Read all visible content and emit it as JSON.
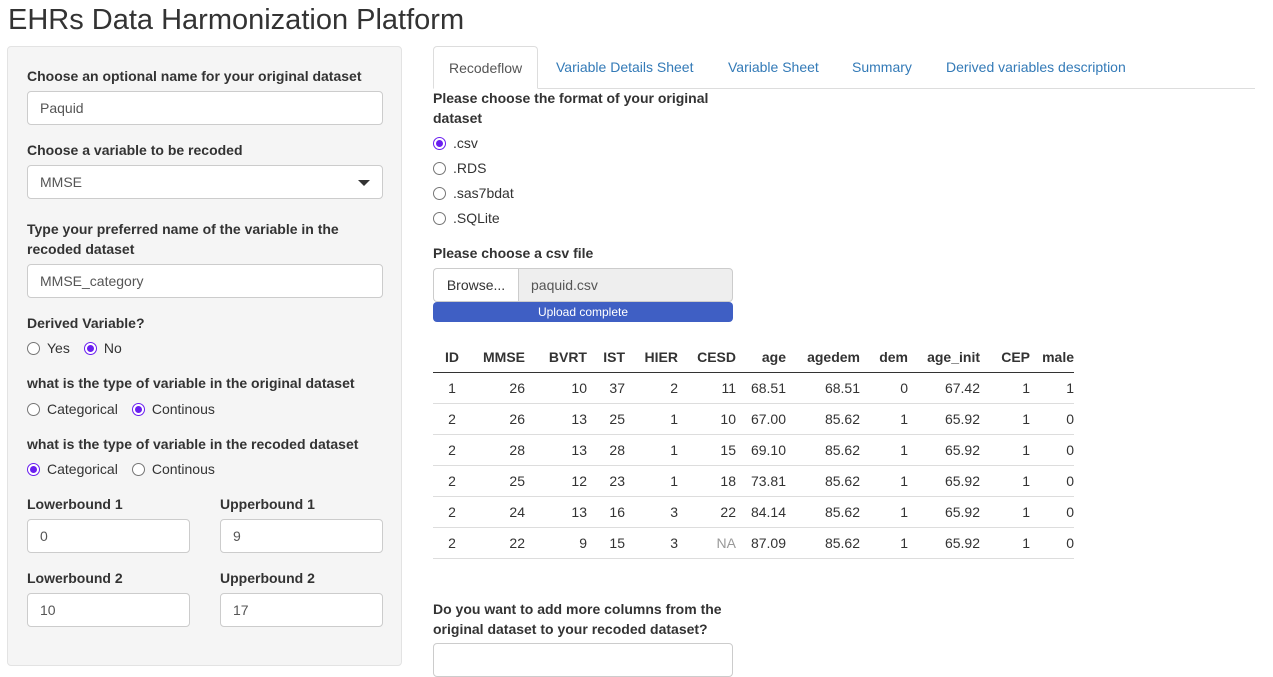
{
  "app": {
    "title": "EHRs Data Harmonization Platform"
  },
  "sidebar": {
    "dataset_name": {
      "label": "Choose an optional name for your original dataset",
      "value": "Paquid"
    },
    "variable": {
      "label": "Choose a variable to be recoded",
      "value": "MMSE"
    },
    "new_name": {
      "label_line1": "Type your preferred name of the variable in the",
      "label_line2": "recoded dataset",
      "value": "MMSE_category"
    },
    "derived": {
      "label": "Derived Variable?",
      "options": [
        "Yes",
        "No"
      ],
      "selected": "No"
    },
    "orig_type": {
      "label": "what is the type of variable in the original dataset",
      "options": [
        "Categorical",
        "Continous"
      ],
      "selected": "Continous"
    },
    "recoded_type": {
      "label": "what is the type of variable in the recoded dataset",
      "options": [
        "Categorical",
        "Continous"
      ],
      "selected": "Categorical"
    },
    "bounds": [
      {
        "lower_label": "Lowerbound 1",
        "lower_value": "0",
        "upper_label": "Upperbound 1",
        "upper_value": "9"
      },
      {
        "lower_label": "Lowerbound 2",
        "lower_value": "10",
        "upper_label": "Upperbound 2",
        "upper_value": "17"
      }
    ]
  },
  "tabs": [
    {
      "label": "Recodeflow",
      "active": true
    },
    {
      "label": "Variable Details Sheet",
      "active": false
    },
    {
      "label": "Variable Sheet",
      "active": false
    },
    {
      "label": "Summary",
      "active": false
    },
    {
      "label": "Derived variables description",
      "active": false
    }
  ],
  "main": {
    "format": {
      "label_line1": "Please choose the format of your original",
      "label_line2": "dataset",
      "options": [
        ".csv",
        ".RDS",
        ".sas7bdat",
        ".SQLite"
      ],
      "selected": ".csv"
    },
    "file": {
      "label": "Please choose a csv file",
      "browse_label": "Browse...",
      "filename": "paquid.csv",
      "progress_text": "Upload complete",
      "progress_percent": 100
    },
    "table": {
      "columns": [
        "ID",
        "MMSE",
        "BVRT",
        "IST",
        "HIER",
        "CESD",
        "age",
        "agedem",
        "dem",
        "age_init",
        "CEP",
        "male"
      ],
      "rows": [
        [
          "1",
          "26",
          "10",
          "37",
          "2",
          "11",
          "68.51",
          "68.51",
          "0",
          "67.42",
          "1",
          "1"
        ],
        [
          "2",
          "26",
          "13",
          "25",
          "1",
          "10",
          "67.00",
          "85.62",
          "1",
          "65.92",
          "1",
          "0"
        ],
        [
          "2",
          "28",
          "13",
          "28",
          "1",
          "15",
          "69.10",
          "85.62",
          "1",
          "65.92",
          "1",
          "0"
        ],
        [
          "2",
          "25",
          "12",
          "23",
          "1",
          "18",
          "73.81",
          "85.62",
          "1",
          "65.92",
          "1",
          "0"
        ],
        [
          "2",
          "24",
          "13",
          "16",
          "3",
          "22",
          "84.14",
          "85.62",
          "1",
          "65.92",
          "1",
          "0"
        ],
        [
          "2",
          "22",
          "9",
          "15",
          "3",
          "NA",
          "87.09",
          "85.62",
          "1",
          "65.92",
          "1",
          "0"
        ]
      ]
    },
    "more_columns": {
      "label_line1": "Do you want to add more columns from the",
      "label_line2": "original dataset to your recoded dataset?"
    }
  },
  "colors": {
    "accent_radio": "#6a1ef0",
    "link": "#337ab7",
    "progress": "#3f5fc4"
  }
}
